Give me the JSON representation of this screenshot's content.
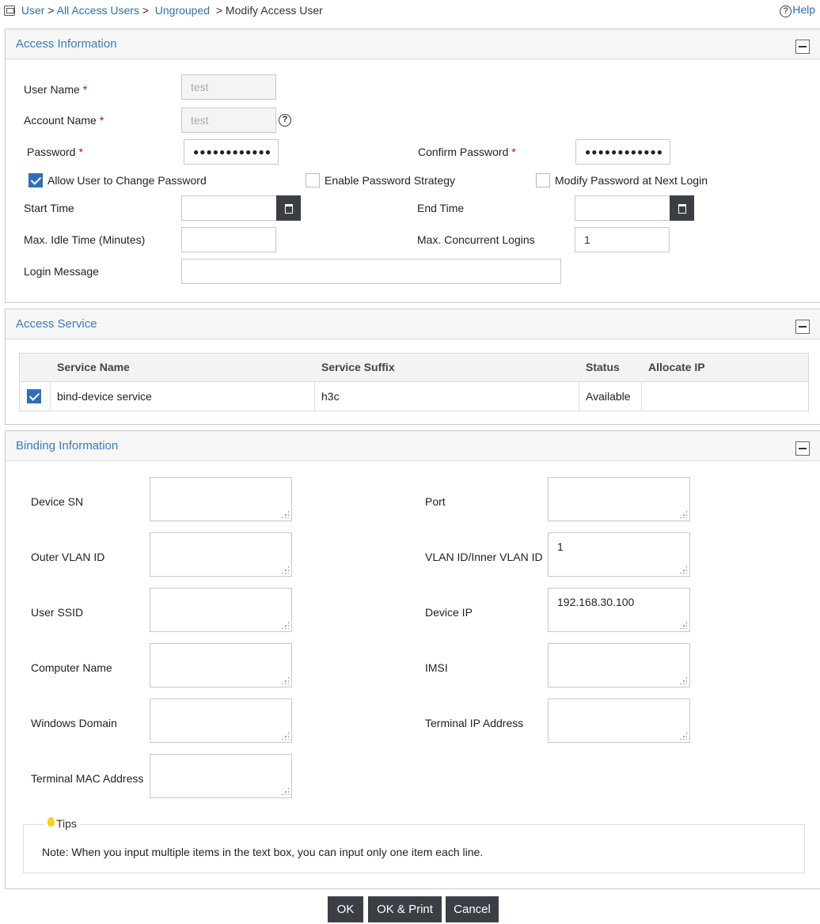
{
  "breadcrumb": {
    "user": "User",
    "sep1": ">",
    "all_access_users": "All Access Users",
    "sep2": ">",
    "ungrouped": "Ungrouped",
    "sep3": ">",
    "current": "Modify Access User"
  },
  "help": {
    "label": "Help"
  },
  "access_information": {
    "title": "Access Information",
    "user_name_label": "User Name",
    "user_name_value": "test",
    "account_name_label": "Account Name",
    "account_name_value": "test",
    "password_label": "Password",
    "password_value": "●●●●●●●●●●●●",
    "confirm_password_label": "Confirm Password",
    "confirm_password_value": "●●●●●●●●●●●●",
    "required_mark": "*",
    "allow_change_password_label": "Allow User to Change Password",
    "allow_change_password_checked": true,
    "enable_password_strategy_label": "Enable Password Strategy",
    "enable_password_strategy_checked": false,
    "modify_password_next_login_label": "Modify Password at Next Login",
    "modify_password_next_login_checked": false,
    "start_time_label": "Start Time",
    "start_time_value": "",
    "end_time_label": "End Time",
    "end_time_value": "",
    "max_idle_label": "Max. Idle Time (Minutes)",
    "max_idle_value": "",
    "max_concurrent_label": "Max. Concurrent Logins",
    "max_concurrent_value": "1",
    "login_message_label": "Login Message",
    "login_message_value": ""
  },
  "access_service": {
    "title": "Access Service",
    "columns": [
      "Service Name",
      "Service Suffix",
      "Status",
      "Allocate IP"
    ],
    "rows": [
      {
        "checked": true,
        "service_name": "bind-device service",
        "service_suffix": "h3c",
        "status": "Available",
        "allocate_ip": ""
      }
    ]
  },
  "binding_information": {
    "title": "Binding Information",
    "device_sn_label": "Device SN",
    "device_sn_value": "",
    "port_label": "Port",
    "port_value": "",
    "outer_vlan_label": "Outer VLAN ID",
    "outer_vlan_value": "",
    "vlan_inner_label": "VLAN ID/Inner VLAN ID",
    "vlan_inner_value": "1",
    "user_ssid_label": "User SSID",
    "user_ssid_value": "",
    "device_ip_label": "Device IP",
    "device_ip_value": "192.168.30.100",
    "computer_name_label": "Computer Name",
    "computer_name_value": "",
    "imsi_label": "IMSI",
    "imsi_value": "",
    "windows_domain_label": "Windows Domain",
    "windows_domain_value": "",
    "terminal_ip_label": "Terminal IP Address",
    "terminal_ip_value": "",
    "terminal_mac_label": "Terminal MAC Address",
    "terminal_mac_value": "",
    "tips_title": "Tips",
    "tips_text": "Note: When you input multiple items in the text box, you can input only one item each line."
  },
  "buttons": {
    "ok": "OK",
    "ok_print": "OK & Print",
    "cancel": "Cancel"
  }
}
